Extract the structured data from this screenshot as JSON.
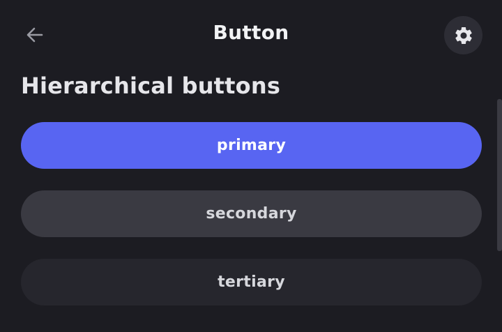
{
  "header": {
    "title": "Button",
    "back_icon": "arrow-left-icon",
    "settings_icon": "gear-icon"
  },
  "section": {
    "heading": "Hierarchical buttons"
  },
  "buttons": [
    {
      "label": "primary"
    },
    {
      "label": "secondary"
    },
    {
      "label": "tertiary"
    }
  ],
  "colors": {
    "background": "#1c1c22",
    "primary": "#5865f2",
    "secondary": "#3a3a42",
    "tertiary": "#26262d"
  }
}
